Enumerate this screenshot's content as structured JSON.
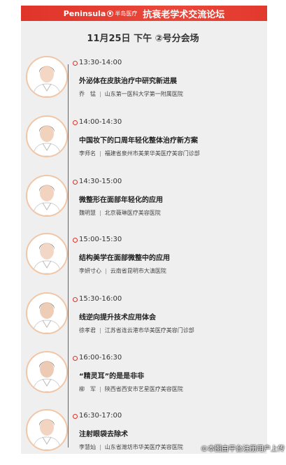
{
  "banner": {
    "logo_en": "Peninsula",
    "logo_cn": "半岛医疗",
    "title": "抗衰老学术交流论坛"
  },
  "session": "11月25日  下午  ②号分会场",
  "schedule": [
    {
      "time": "13:30-14:00",
      "topic": "外泌体在皮肤治疗中研究新进展",
      "name": "乔　锰",
      "org": "山东第一医科大学第一附属医院"
    },
    {
      "time": "14:00-14:30",
      "topic": "中国妆下的口周年轻化整体治疗新方案",
      "name": "李师名",
      "org": "福建省泉州市美莱华美医疗美容门诊部"
    },
    {
      "time": "14:30-15:00",
      "topic": "微整形在面部年轻化的应用",
      "name": "魏明慧",
      "org": "北京薇琳医疗美容医院"
    },
    {
      "time": "15:00-15:30",
      "topic": "结构美学在面部微整中的应用",
      "name": "李妍寸心",
      "org": "云南省昆明市大滇医院"
    },
    {
      "time": "15:30-16:00",
      "topic": "线逆向提升技术应用体会",
      "name": "徐孝君",
      "org": "江苏省连云港市华美医疗美容门诊部"
    },
    {
      "time": "16:00-16:30",
      "topic": "“精灵耳”的是是非非",
      "name": "柳　军",
      "org": "陕西省西安市艺星医疗美容医院"
    },
    {
      "time": "16:30-17:00",
      "topic": "注射眼袋去除术",
      "name": "李慧灿",
      "org": "山东省潍坊市华美医疗美容医院"
    }
  ],
  "watermark": "©本图由平台注册用户上传",
  "colors": {
    "accent": "#d7332a",
    "card": "#efefef"
  }
}
